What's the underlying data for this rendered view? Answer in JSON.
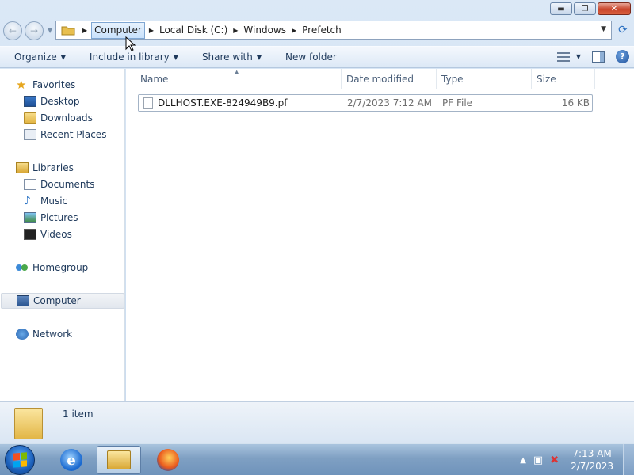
{
  "window": {
    "controls": {
      "minimize": "▬",
      "maximize": "❐",
      "close": "✕"
    }
  },
  "nav": {
    "back_icon": "←",
    "forward_icon": "→",
    "breadcrumbs": [
      "Computer",
      "Local Disk (C:)",
      "Windows",
      "Prefetch"
    ],
    "address_dropdown": "▼",
    "refresh_icon": "⟳"
  },
  "toolbar": {
    "organize": "Organize",
    "include_in_library": "Include in library",
    "share_with": "Share with",
    "new_folder": "New folder",
    "help": "?"
  },
  "sidebar": {
    "favorites": {
      "label": "Favorites",
      "items": [
        "Desktop",
        "Downloads",
        "Recent Places"
      ]
    },
    "libraries": {
      "label": "Libraries",
      "items": [
        "Documents",
        "Music",
        "Pictures",
        "Videos"
      ]
    },
    "homegroup": "Homegroup",
    "computer": "Computer",
    "network": "Network"
  },
  "columns": [
    "Name",
    "Date modified",
    "Type",
    "Size"
  ],
  "files": [
    {
      "name": "DLLHOST.EXE-824949B9.pf",
      "date_modified": "2/7/2023 7:12 AM",
      "type": "PF File",
      "size": "16 KB"
    }
  ],
  "details": {
    "item_count": "1 item"
  },
  "taskbar": {
    "clock_time": "7:13 AM",
    "clock_date": "2/7/2023",
    "tray_arrow": "▲",
    "ie_glyph": "e"
  }
}
